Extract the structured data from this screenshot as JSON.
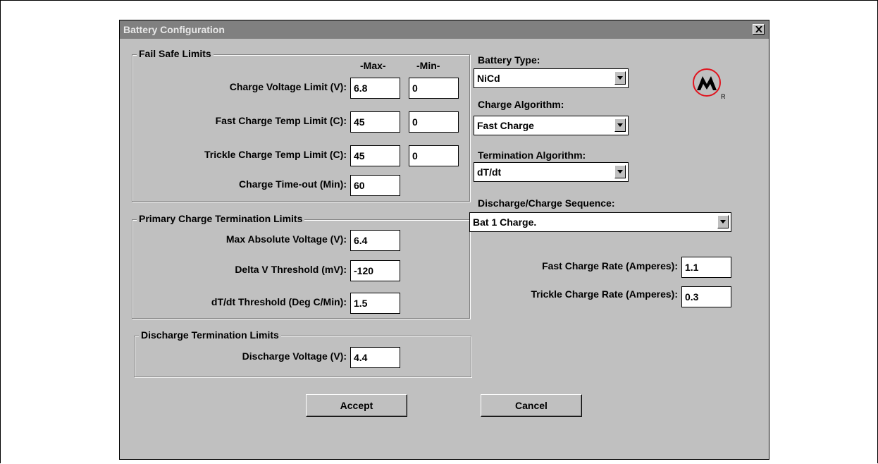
{
  "window": {
    "title": "Battery Configuration",
    "close_glyph": "close-icon"
  },
  "fail_safe": {
    "legend": "Fail Safe Limits",
    "col_max": "-Max-",
    "col_min": "-Min-",
    "rows": [
      {
        "label": "Charge Voltage Limit (V):",
        "max": "6.8",
        "min": "0"
      },
      {
        "label": "Fast Charge Temp Limit (C):",
        "max": "45",
        "min": "0"
      },
      {
        "label": "Trickle Charge Temp Limit (C):",
        "max": "45",
        "min": "0"
      },
      {
        "label": "Charge Time-out (Min):",
        "max": "60"
      }
    ]
  },
  "primary": {
    "legend": "Primary Charge Termination Limits",
    "rows": [
      {
        "label": "Max Absolute Voltage (V):",
        "value": "6.4"
      },
      {
        "label": "Delta V Threshold (mV):",
        "value": "-120"
      },
      {
        "label": "dT/dt Threshold (Deg C/Min):",
        "value": "1.5"
      }
    ]
  },
  "discharge": {
    "legend": "Discharge Termination Limits",
    "label": "Discharge Voltage (V):",
    "value": "4.4"
  },
  "right": {
    "battery_type_label": "Battery Type:",
    "battery_type_value": "NiCd",
    "charge_algorithm_label": "Charge Algorithm:",
    "charge_algorithm_value": "Fast Charge",
    "termination_label": "Termination Algorithm:",
    "termination_value": "dT/dt",
    "sequence_label": "Discharge/Charge Sequence:",
    "sequence_value": "Bat 1 Charge.",
    "fast_rate_label": "Fast Charge Rate (Amperes):",
    "fast_rate_value": "1.1",
    "trickle_rate_label": "Trickle Charge Rate (Amperes):",
    "trickle_rate_value": "0.3"
  },
  "logo": {
    "mark": "R"
  },
  "buttons": {
    "accept": "Accept",
    "cancel": "Cancel"
  },
  "colors": {
    "dialog_bg": "#c0c0c0",
    "titlebar_bg": "#808080",
    "logo_red": "#e0141e"
  }
}
